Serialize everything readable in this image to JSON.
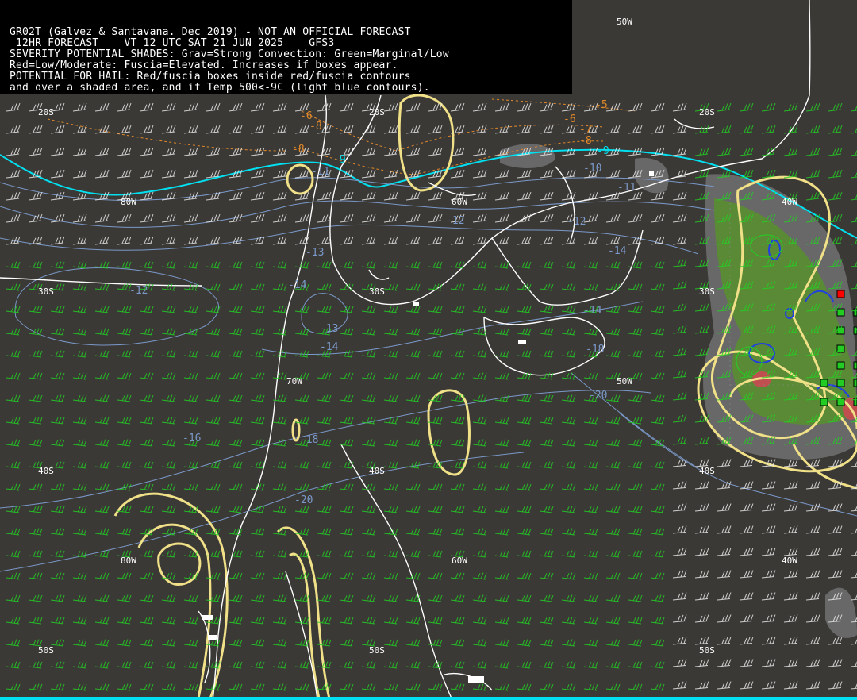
{
  "header": {
    "lines": [
      "GR02T (Galvez & Santavana. Dec 2019) - NOT AN OFFICIAL FORECAST",
      " 12HR FORECAST    VT 12 UTC SAT 21 JUN 2025    GFS3",
      "SEVERITY POTENTIAL SHADES: Grav=Strong Convection: Green=Marginal/Low",
      "Red=Low/Moderate: Fuscia=Elevated. Increases if boxes appear.",
      "POTENTIAL FOR HAIL: Red/fuscia boxes inside red/fuscia contours",
      "and over a shaded area, and if Temp 500<-9C (light blue contours)."
    ]
  },
  "grid_labels": {
    "lon_50w_top": "50W",
    "lat_20s_left": "20S",
    "lat_20s_mid": "20S",
    "lat_20s_right": "20S",
    "lon_80w_top": "80W",
    "lon_60w_top": "60W",
    "lon_40w_top": "40W",
    "lat_30s_left": "30S",
    "lat_30s_mid": "30S",
    "lat_30s_right": "30S",
    "lon_70w_mid": "70W",
    "lon_50w_mid": "50W",
    "lat_40s_left": "40S",
    "lat_40s_mid": "40S",
    "lat_40s_right": "40S",
    "lon_80w_bottom": "80W",
    "lon_60w_bottom": "60W",
    "lon_40w_bottom": "40W",
    "lat_50s_left": "50S",
    "lat_50s_mid": "50S",
    "lat_50s_right": "50S"
  },
  "temp_labels": {
    "orange_neg5": "-5",
    "orange_neg6_left": "-6",
    "orange_neg6_right": "-6",
    "orange_neg7": "-7",
    "orange_neg8_left": "-8",
    "orange_neg8_mid": "-8",
    "orange_neg8_right": "-8",
    "cyan_neg9_left": "-9",
    "cyan_neg9_right": "-9",
    "blue_neg10": "-10",
    "blue_neg11_left": "-11",
    "blue_neg11_right": "-11",
    "blue_neg12_left": "-12",
    "blue_neg12_mid": "-12",
    "blue_neg12_right": "-12",
    "blue_neg13_left": "-13",
    "blue_neg13_right": "-13",
    "blue_neg14_a": "-14",
    "blue_neg14_b": "-14",
    "blue_neg14_c": "-14",
    "blue_neg14_d": "-14",
    "blue_neg16": "-16",
    "blue_neg18_a": "-18",
    "blue_neg18_b": "-18",
    "blue_neg20_a": "-20",
    "blue_neg20_b": "-20"
  },
  "colors": {
    "background": "#3b3936",
    "coastline": "#ffffff",
    "temp_cold": "#00e0f0",
    "temp_warm": "#e0882a",
    "temp_isotherm": "#7a98c8",
    "severity_contour": "#f0e088",
    "wind_barb_green": "#22d022",
    "wind_barb_white": "#e8e8e8",
    "shade_strong": "#6e6e6e",
    "shade_marginal": "#5a8a36",
    "shade_moderate": "#c05050",
    "hail_box_red": "#ff0000",
    "hail_box_green": "#22cc22"
  }
}
